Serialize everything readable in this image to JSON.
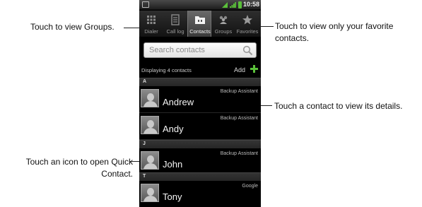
{
  "callouts": {
    "groups": "Touch to view Groups.",
    "favorites": "Touch to view only your favorite contacts.",
    "contact_details": "Touch a contact to view its details.",
    "quick_contact": "Touch an icon to open Quick Contact."
  },
  "status_bar": {
    "time": "10:58"
  },
  "tabs": [
    {
      "label": "Dialer",
      "icon": "dialer-icon",
      "selected": false
    },
    {
      "label": "Call log",
      "icon": "call-log-icon",
      "selected": false
    },
    {
      "label": "Contacts",
      "icon": "contacts-icon",
      "selected": true
    },
    {
      "label": "Groups",
      "icon": "groups-icon",
      "selected": false
    },
    {
      "label": "Favorites",
      "icon": "star-icon",
      "selected": false
    }
  ],
  "search": {
    "placeholder": "Search contacts"
  },
  "list_header": {
    "count_text": "Displaying 4 contacts",
    "add_label": "Add"
  },
  "sections": [
    {
      "letter": "A",
      "contacts": [
        {
          "name": "Andrew",
          "account": "Backup Assistant"
        },
        {
          "name": "Andy",
          "account": "Backup Assistant"
        }
      ]
    },
    {
      "letter": "J",
      "contacts": [
        {
          "name": "John",
          "account": "Backup Assistant"
        }
      ]
    },
    {
      "letter": "T",
      "contacts": [
        {
          "name": "Tony",
          "account": "Google"
        }
      ]
    }
  ],
  "colors": {
    "add_icon": "#5ac03a",
    "battery": "#5ac03a",
    "screen_bg": "#000000"
  }
}
